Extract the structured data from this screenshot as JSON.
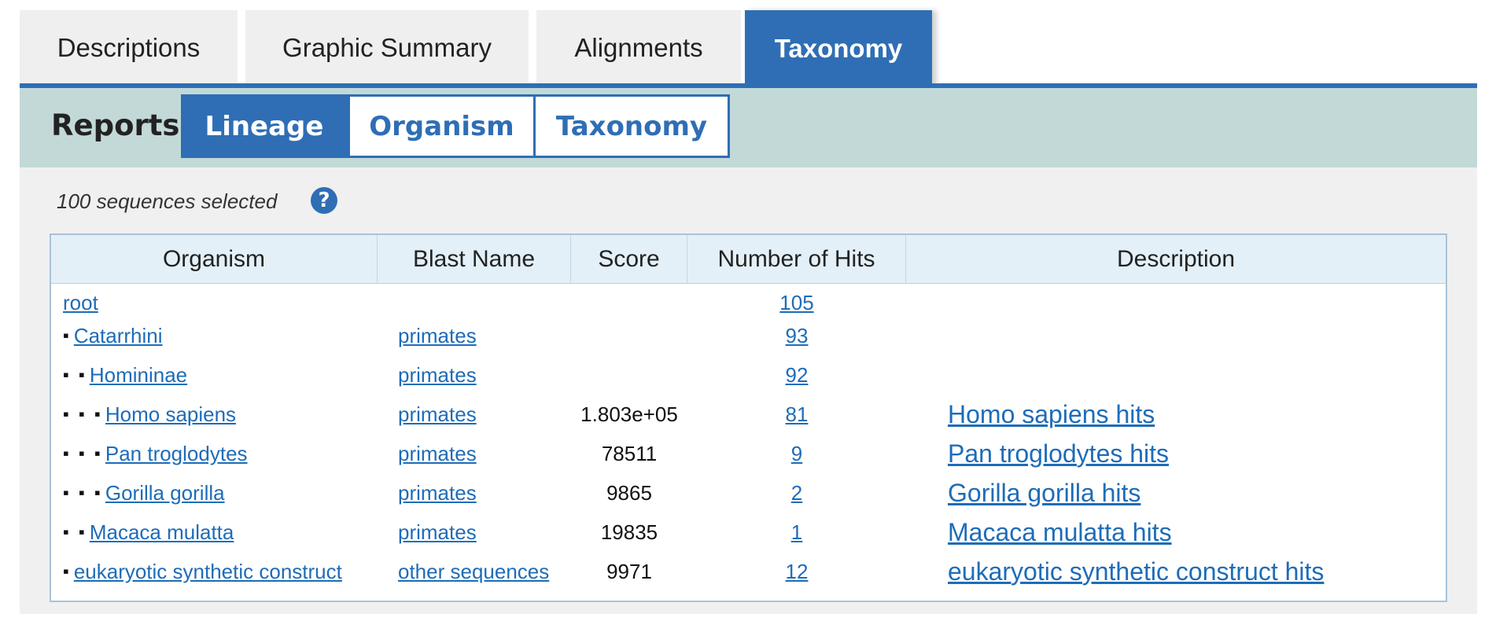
{
  "tabs": [
    {
      "label": "Descriptions",
      "active": false
    },
    {
      "label": "Graphic Summary",
      "active": false
    },
    {
      "label": "Alignments",
      "active": false
    },
    {
      "label": "Taxonomy",
      "active": true
    }
  ],
  "reports": {
    "label": "Reports",
    "buttons": [
      {
        "label": "Lineage",
        "active": true
      },
      {
        "label": "Organism",
        "active": false
      },
      {
        "label": "Taxonomy",
        "active": false
      }
    ]
  },
  "selection": {
    "text": "100 sequences selected",
    "help_icon": "question-circle-icon"
  },
  "table": {
    "headers": [
      "Organism",
      "Blast Name",
      "Score",
      "Number of Hits",
      "Description"
    ],
    "rows": [
      {
        "depth": 0,
        "organism": "root",
        "blast_name": "",
        "score": "",
        "hits": "105",
        "description": ""
      },
      {
        "depth": 1,
        "organism": "Catarrhini",
        "blast_name": "primates",
        "score": "",
        "hits": "93",
        "description": ""
      },
      {
        "depth": 2,
        "organism": "Homininae",
        "blast_name": "primates",
        "score": "",
        "hits": "92",
        "description": ""
      },
      {
        "depth": 3,
        "organism": "Homo sapiens",
        "blast_name": "primates",
        "score": "1.803e+05",
        "hits": "81",
        "description": "Homo sapiens hits"
      },
      {
        "depth": 3,
        "organism": "Pan troglodytes",
        "blast_name": "primates",
        "score": "78511",
        "hits": "9",
        "description": "Pan troglodytes hits"
      },
      {
        "depth": 3,
        "organism": "Gorilla gorilla",
        "blast_name": "primates",
        "score": "9865",
        "hits": "2",
        "description": "Gorilla gorilla hits"
      },
      {
        "depth": 2,
        "organism": "Macaca mulatta",
        "blast_name": "primates",
        "score": "19835",
        "hits": "1",
        "description": "Macaca mulatta hits"
      },
      {
        "depth": 1,
        "organism": "eukaryotic synthetic construct",
        "blast_name": "other sequences",
        "score": "9971",
        "hits": "12",
        "description": "eukaryotic synthetic construct hits"
      }
    ]
  },
  "colors": {
    "accent": "#2f6eb5",
    "link": "#1e6cb8",
    "reports_bar": "#c2d9d8",
    "header_bg": "#e3f0f7"
  }
}
